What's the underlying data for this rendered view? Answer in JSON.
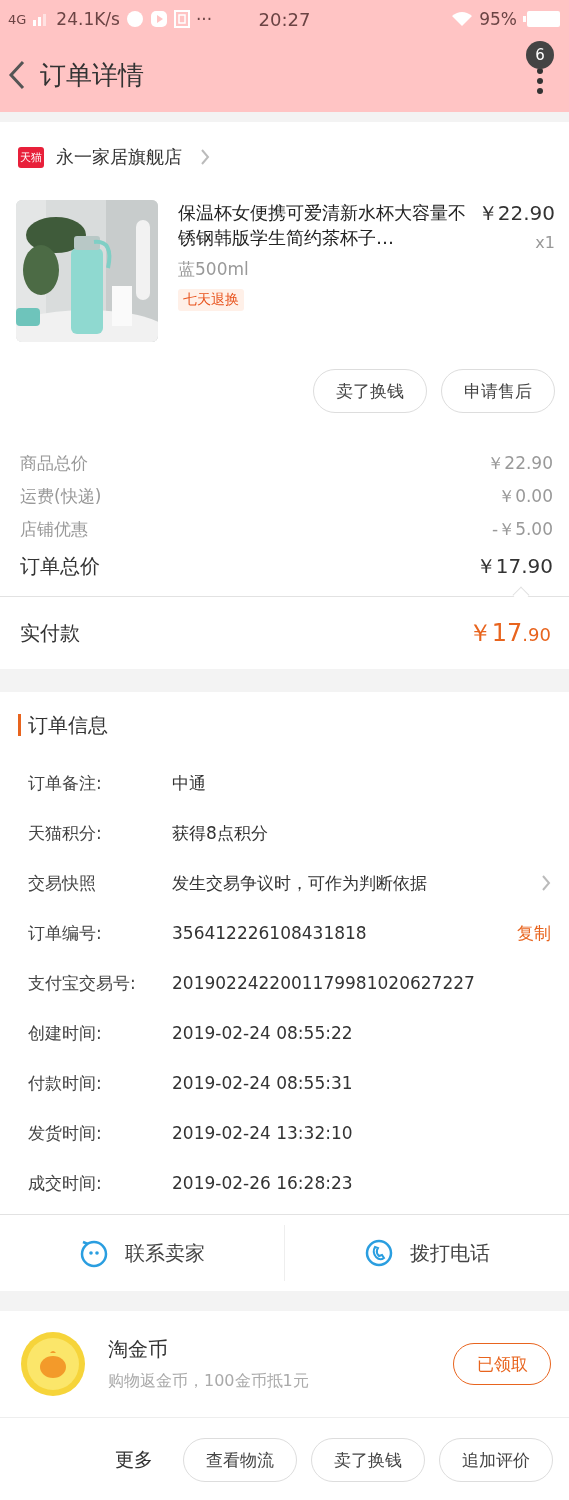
{
  "status_bar": {
    "network": "4G",
    "speed": "24.1K/s",
    "more": "···",
    "time": "20:27",
    "battery": "95%"
  },
  "header": {
    "title": "订单详情",
    "badge": "6"
  },
  "store": {
    "badge": "天猫",
    "name": "永一家居旗舰店"
  },
  "product": {
    "title": "保温杯女便携可爱清新水杯大容量不锈钢韩版学生简约茶杯子…",
    "price": "￥22.90",
    "quantity": "x1",
    "sku": "蓝500ml",
    "tag": "七天退换"
  },
  "product_actions": [
    "卖了换钱",
    "申请售后"
  ],
  "price_rows": [
    {
      "kind": "minor",
      "label": "商品总价",
      "value": "￥22.90"
    },
    {
      "kind": "minor",
      "label": "运费(快递)",
      "value": "￥0.00"
    },
    {
      "kind": "minor",
      "label": "店铺优惠",
      "value": "-￥5.00"
    },
    {
      "kind": "total",
      "label": "订单总价",
      "value": "￥17.90"
    }
  ],
  "paid": {
    "label": "实付款",
    "amount": "￥17",
    "cents": ".90"
  },
  "order_info": {
    "title": "订单信息",
    "rows": [
      {
        "label": "订单备注:",
        "value": "中通"
      },
      {
        "label": "天猫积分:",
        "value": "获得8点积分"
      },
      {
        "label": "交易快照",
        "value": "发生交易争议时，可作为判断依据",
        "chevron": true
      },
      {
        "label": "订单编号:",
        "value": "356412226108431818",
        "action": "复制"
      },
      {
        "label": "支付宝交易号:",
        "value": "2019022422001179981020627227"
      },
      {
        "label": "创建时间:",
        "value": "2019-02-24 08:55:22"
      },
      {
        "label": "付款时间:",
        "value": "2019-02-24 08:55:31"
      },
      {
        "label": "发货时间:",
        "value": "2019-02-24 13:32:10"
      },
      {
        "label": "成交时间:",
        "value": "2019-02-26 16:28:23"
      }
    ]
  },
  "contact": [
    {
      "kind": "chat",
      "label": "联系卖家"
    },
    {
      "kind": "phone",
      "label": "拨打电话"
    }
  ],
  "coins": {
    "title": "淘金币",
    "subtitle": "购物返金币，100金币抵1元",
    "button": "已领取"
  },
  "footer": {
    "more": "更多",
    "buttons": [
      "查看物流",
      "卖了换钱",
      "追加评价"
    ]
  }
}
